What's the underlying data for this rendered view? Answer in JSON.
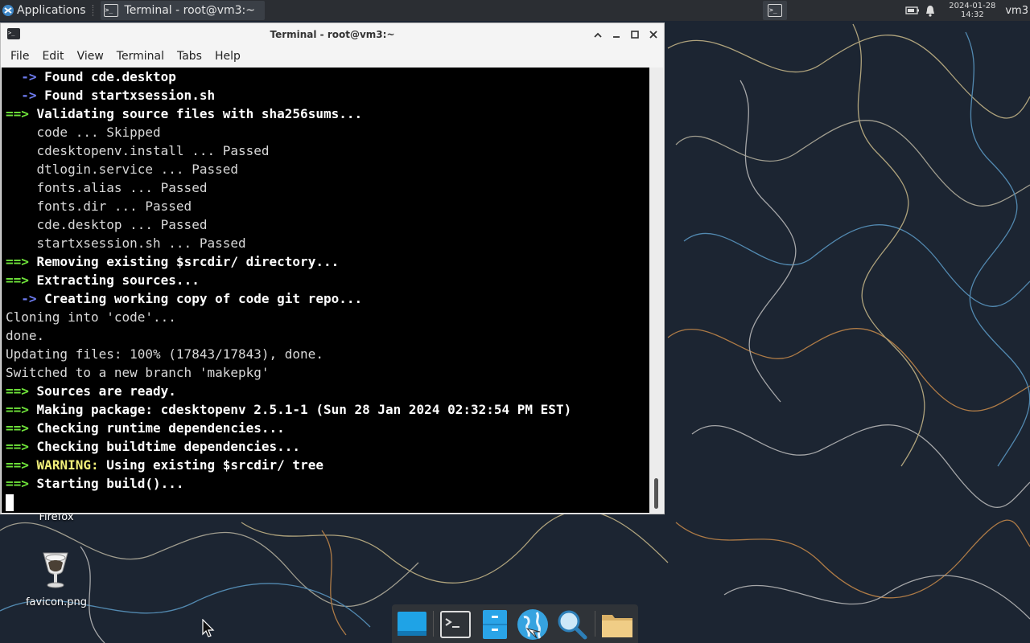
{
  "top_panel": {
    "apps_label": "Applications",
    "task_title": "Terminal - root@vm3:~",
    "clock_date": "2024-01-28",
    "clock_time": "14:32",
    "user": "vm3"
  },
  "window": {
    "title": "Terminal - root@vm3:~",
    "menu": [
      "File",
      "Edit",
      "View",
      "Terminal",
      "Tabs",
      "Help"
    ]
  },
  "terminal": {
    "lines": [
      {
        "prefix": "  ->",
        "prefix_style": "blue",
        "text": " Found cde.desktop",
        "text_style": "bold"
      },
      {
        "prefix": "  ->",
        "prefix_style": "blue",
        "text": " Found startxsession.sh",
        "text_style": "bold"
      },
      {
        "prefix": "==>",
        "prefix_style": "green",
        "text": " Validating source files with sha256sums...",
        "text_style": "bold"
      },
      {
        "prefix": "",
        "prefix_style": "",
        "text": "    code ... Skipped",
        "text_style": "normal"
      },
      {
        "prefix": "",
        "prefix_style": "",
        "text": "    cdesktopenv.install ... Passed",
        "text_style": "normal"
      },
      {
        "prefix": "",
        "prefix_style": "",
        "text": "    dtlogin.service ... Passed",
        "text_style": "normal"
      },
      {
        "prefix": "",
        "prefix_style": "",
        "text": "    fonts.alias ... Passed",
        "text_style": "normal"
      },
      {
        "prefix": "",
        "prefix_style": "",
        "text": "    fonts.dir ... Passed",
        "text_style": "normal"
      },
      {
        "prefix": "",
        "prefix_style": "",
        "text": "    cde.desktop ... Passed",
        "text_style": "normal"
      },
      {
        "prefix": "",
        "prefix_style": "",
        "text": "    startxsession.sh ... Passed",
        "text_style": "normal"
      },
      {
        "prefix": "==>",
        "prefix_style": "green",
        "text": " Removing existing $srcdir/ directory...",
        "text_style": "bold"
      },
      {
        "prefix": "==>",
        "prefix_style": "green",
        "text": " Extracting sources...",
        "text_style": "bold"
      },
      {
        "prefix": "  ->",
        "prefix_style": "blue",
        "text": " Creating working copy of code git repo...",
        "text_style": "bold"
      },
      {
        "prefix": "",
        "prefix_style": "",
        "text": "Cloning into 'code'...",
        "text_style": "normal"
      },
      {
        "prefix": "",
        "prefix_style": "",
        "text": "done.",
        "text_style": "normal"
      },
      {
        "prefix": "",
        "prefix_style": "",
        "text": "Updating files: 100% (17843/17843), done.",
        "text_style": "normal"
      },
      {
        "prefix": "",
        "prefix_style": "",
        "text": "Switched to a new branch 'makepkg'",
        "text_style": "normal"
      },
      {
        "prefix": "==>",
        "prefix_style": "green",
        "text": " Sources are ready.",
        "text_style": "bold"
      },
      {
        "prefix": "==>",
        "prefix_style": "green",
        "text": " Making package: cdesktopenv 2.5.1-1 (Sun 28 Jan 2024 02:32:54 PM EST)",
        "text_style": "bold"
      },
      {
        "prefix": "==>",
        "prefix_style": "green",
        "text": " Checking runtime dependencies...",
        "text_style": "bold"
      },
      {
        "prefix": "==>",
        "prefix_style": "green",
        "text": " Checking buildtime dependencies...",
        "text_style": "bold"
      },
      {
        "prefix": "==>",
        "prefix_style": "green",
        "text": " ",
        "text_style": "bold",
        "warning": "WARNING:",
        "after": " Using existing $srcdir/ tree"
      },
      {
        "prefix": "==>",
        "prefix_style": "green",
        "text": " Starting build()...",
        "text_style": "bold"
      }
    ]
  },
  "desktop": {
    "icons": [
      {
        "label": "Firefox"
      },
      {
        "label": "favicon.png"
      }
    ]
  },
  "dock": {
    "items": [
      "desktop-show",
      "terminal",
      "file-manager-blue",
      "web-browser",
      "app-finder",
      "home-folder"
    ]
  },
  "colors": {
    "panel_bg": "#2b2e33",
    "terminal_bg": "#000000",
    "prompt_green": "#6fe33a",
    "prompt_blue": "#6d7bf0",
    "warning_yellow": "#f2f07a"
  }
}
